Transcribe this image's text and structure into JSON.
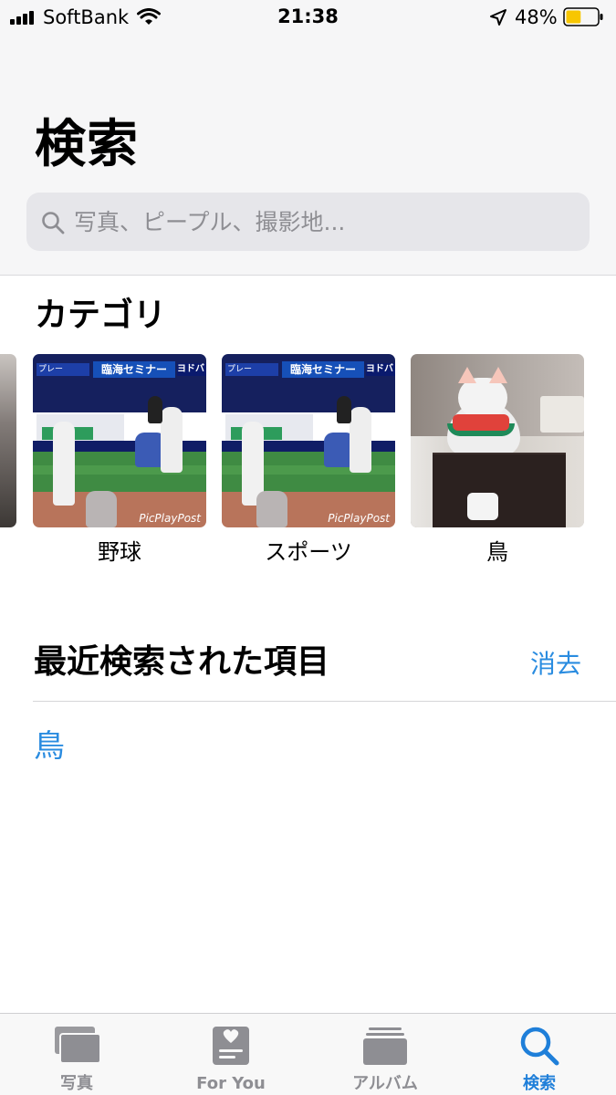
{
  "status_bar": {
    "carrier": "SoftBank",
    "time": "21:38",
    "battery_percent": "48%",
    "battery_level": 0.48,
    "battery_color": "#f7c601"
  },
  "header": {
    "title": "検索",
    "search_placeholder": "写真、ピープル、撮影地..."
  },
  "categories": {
    "title": "カテゴリ",
    "items": [
      {
        "label": "野球",
        "image": "baseball-photo"
      },
      {
        "label": "スポーツ",
        "image": "baseball-photo"
      },
      {
        "label": "鳥",
        "image": "cat-photo"
      }
    ],
    "thumbnail_text": {
      "banner_left": "プレー",
      "banner_center": "臨海セミナー",
      "banner_right": "ヨドバ",
      "watermark": "PicPlayPost"
    }
  },
  "recent": {
    "title": "最近検索された項目",
    "clear_label": "消去",
    "items": [
      "鳥"
    ]
  },
  "tab_bar": {
    "tabs": [
      {
        "label": "写真",
        "icon": "photos-icon",
        "active": false
      },
      {
        "label": "For You",
        "icon": "for-you-icon",
        "active": false
      },
      {
        "label": "アルバム",
        "icon": "albums-icon",
        "active": false
      },
      {
        "label": "検索",
        "icon": "search-icon",
        "active": true
      }
    ]
  },
  "colors": {
    "accent": "#1f7fd9",
    "link": "#2a8ce0",
    "inactive_tab": "#8e8e93"
  }
}
